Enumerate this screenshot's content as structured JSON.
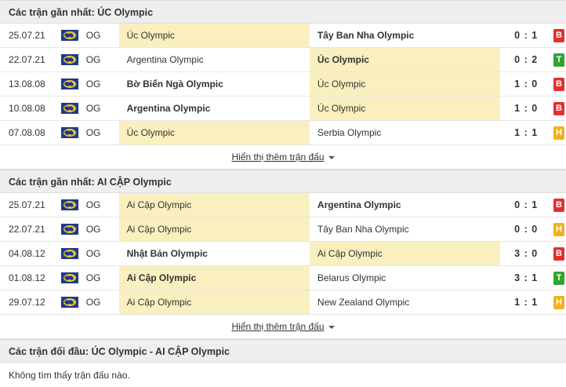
{
  "colors": {
    "win": "#2fa52f",
    "loss": "#e03030",
    "draw": "#f0b21a",
    "highlight": "#faefbf"
  },
  "section1": {
    "title": "Các trận gần nhất: ÚC Olympic",
    "rows": [
      {
        "date": "25.07.21",
        "comp": "OG",
        "home": "Úc Olympic",
        "away": "Tây Ban Nha Olympic",
        "score": "0 : 1",
        "result": "B",
        "hl": "home",
        "bold": "away"
      },
      {
        "date": "22.07.21",
        "comp": "OG",
        "home": "Argentina Olympic",
        "away": "Úc Olympic",
        "score": "0 : 2",
        "result": "T",
        "hl": "away",
        "bold": "away"
      },
      {
        "date": "13.08.08",
        "comp": "OG",
        "home": "Bờ Biển Ngà Olympic",
        "away": "Úc Olympic",
        "score": "1 : 0",
        "result": "B",
        "hl": "away",
        "bold": "home"
      },
      {
        "date": "10.08.08",
        "comp": "OG",
        "home": "Argentina Olympic",
        "away": "Úc Olympic",
        "score": "1 : 0",
        "result": "B",
        "hl": "away",
        "bold": "home"
      },
      {
        "date": "07.08.08",
        "comp": "OG",
        "home": "Úc Olympic",
        "away": "Serbia Olympic",
        "score": "1 : 1",
        "result": "H",
        "hl": "home",
        "bold": ""
      }
    ],
    "more": "Hiển thị thêm trận đấu"
  },
  "section2": {
    "title": "Các trận gần nhất: AI CẬP Olympic",
    "rows": [
      {
        "date": "25.07.21",
        "comp": "OG",
        "home": "Ai Cập Olympic",
        "away": "Argentina Olympic",
        "score": "0 : 1",
        "result": "B",
        "hl": "home",
        "bold": "away"
      },
      {
        "date": "22.07.21",
        "comp": "OG",
        "home": "Ai Cập Olympic",
        "away": "Tây Ban Nha Olympic",
        "score": "0 : 0",
        "result": "H",
        "hl": "home",
        "bold": ""
      },
      {
        "date": "04.08.12",
        "comp": "OG",
        "home": "Nhật Bản Olympic",
        "away": "Ai Cập Olympic",
        "score": "3 : 0",
        "result": "B",
        "hl": "away",
        "bold": "home"
      },
      {
        "date": "01.08.12",
        "comp": "OG",
        "home": "Ai Cập Olympic",
        "away": "Belarus Olympic",
        "score": "3 : 1",
        "result": "T",
        "hl": "home",
        "bold": "home"
      },
      {
        "date": "29.07.12",
        "comp": "OG",
        "home": "Ai Cập Olympic",
        "away": "New Zealand Olympic",
        "score": "1 : 1",
        "result": "H",
        "hl": "home",
        "bold": ""
      }
    ],
    "more": "Hiển thị thêm trận đấu"
  },
  "section3": {
    "title": "Các trận đối đầu: ÚC Olympic - AI CẬP Olympic",
    "empty": "Không tìm thấy trận đấu nào."
  }
}
